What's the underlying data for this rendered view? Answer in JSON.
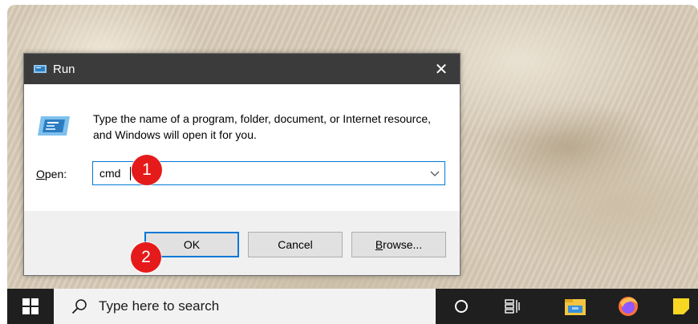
{
  "dialog": {
    "title": "Run",
    "close_glyph": "✕",
    "description": "Type the name of a program, folder, document, or Internet resource, and Windows will open it for you.",
    "open_label_underlined": "O",
    "open_label_rest": "pen:",
    "input_value": "cmd",
    "buttons": {
      "ok": "OK",
      "cancel": "Cancel",
      "browse_underlined": "B",
      "browse_rest": "rowse..."
    }
  },
  "annotations": {
    "step1": "1",
    "step2": "2"
  },
  "taskbar": {
    "search_placeholder": "Type here to search",
    "icons": [
      "windows-start-icon",
      "search-icon",
      "cortana-icon",
      "task-view-icon",
      "file-explorer-icon",
      "firefox-icon",
      "sticky-notes-icon"
    ]
  },
  "colors": {
    "accent": "#0078d7",
    "titlebar": "#3b3b3b",
    "badge": "#e51a1a",
    "taskbar_dark": "#1f1f1f"
  }
}
